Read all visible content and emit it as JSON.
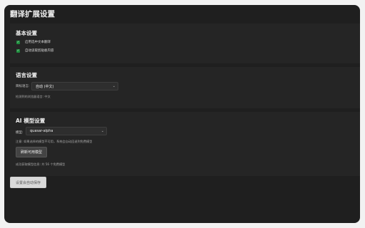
{
  "page": {
    "title": "翻译扩展设置"
  },
  "basic": {
    "title": "基本设置",
    "options": [
      {
        "label": "启用选中文本翻译",
        "checked": true
      },
      {
        "label": "自动读取剪贴板内容",
        "checked": true
      }
    ]
  },
  "language": {
    "title": "语言设置",
    "target_label": "目标语言:",
    "target_value": "自动 (中文)",
    "detected_hint": "检测到的浏览器语言: 中文"
  },
  "ai": {
    "title": "AI 模型设置",
    "model_label": "模型:",
    "model_value": "quasar-alpha",
    "warning": "注意: 如果选择的模型不可用，系统会自动回退到免费模型",
    "refresh_label": "刷新可用模型",
    "fetch_status": "成功获取模型信息: 共 56 个免费模型"
  },
  "footer": {
    "autosave_label": "设置会自动保存"
  }
}
